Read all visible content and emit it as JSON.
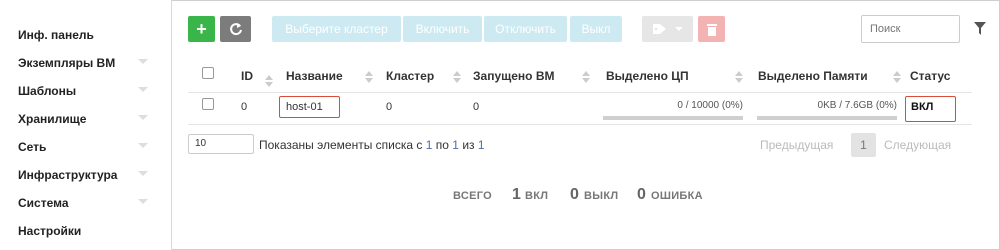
{
  "sidebar": {
    "items": [
      {
        "label": "Инф. панель",
        "chevron": false
      },
      {
        "label": "Экземпляры ВМ",
        "chevron": true
      },
      {
        "label": "Шаблоны",
        "chevron": true
      },
      {
        "label": "Хранилище",
        "chevron": true
      },
      {
        "label": "Сеть",
        "chevron": true
      },
      {
        "label": "Инфраструктура",
        "chevron": true
      },
      {
        "label": "Система",
        "chevron": true
      },
      {
        "label": "Настройки",
        "chevron": false
      }
    ]
  },
  "toolbar": {
    "add_label": "+",
    "select_cluster_label": "Выберите кластер",
    "enable_label": "Включить",
    "disable_label": "Отключить",
    "off_label": "Выкл",
    "search_placeholder": "Поиск"
  },
  "table": {
    "headers": {
      "id": "ID",
      "name": "Название",
      "cluster": "Кластер",
      "running_vms": "Запущено ВМ",
      "alloc_cpu": "Выделено ЦП",
      "alloc_mem": "Выделено Памяти",
      "status": "Статус"
    },
    "rows": [
      {
        "id": "0",
        "name": "host-01",
        "cluster": "0",
        "running_vms": "0",
        "cpu_label": "0 / 10000 (0%)",
        "cpu_fraction": 0,
        "mem_label": "0KB / 7.6GB (0%)",
        "mem_fraction": 0,
        "status": "ВКЛ"
      }
    ]
  },
  "pager": {
    "page_size": "10",
    "info_prefix": "Показаны элементы списка с",
    "from": "1",
    "info_mid1": "по",
    "to": "1",
    "info_mid2": "из",
    "total": "1",
    "prev_label": "Предыдущая",
    "current_page": "1",
    "next_label": "Следующая"
  },
  "summary": {
    "total_label": "ВСЕГО",
    "on_count": "1",
    "on_label": "ВКЛ",
    "off_count": "0",
    "off_label": "ВЫКЛ",
    "error_count": "0",
    "error_label": "ОШИБКА"
  },
  "colors": {
    "accent_green": "#3ab54a",
    "highlight_red": "#d84d3a",
    "link_blue": "#4a6ea8"
  }
}
